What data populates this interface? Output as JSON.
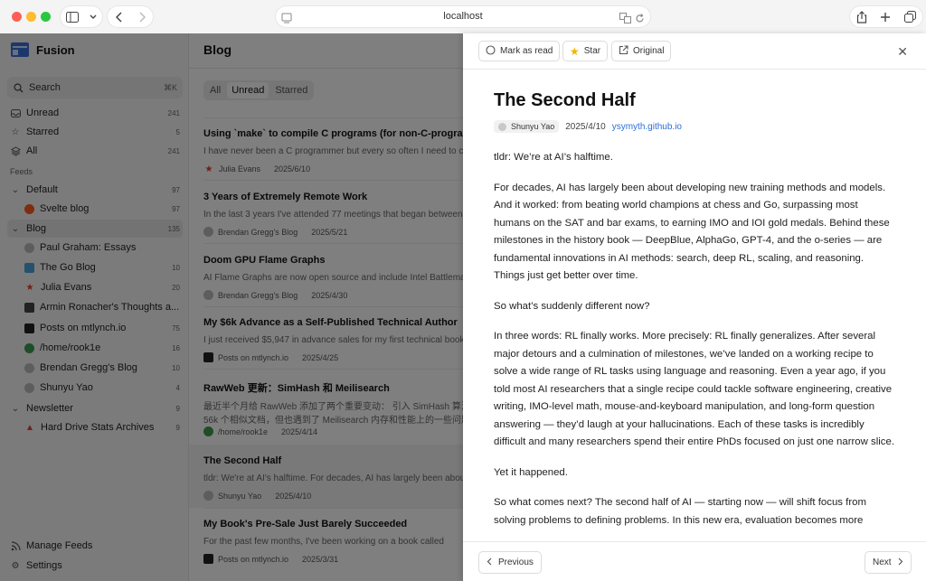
{
  "browser": {
    "url": "localhost"
  },
  "app": {
    "name": "Fusion"
  },
  "sidebar": {
    "search": {
      "label": "Search",
      "shortcut": "⌘K"
    },
    "nav": [
      {
        "label": "Unread",
        "count": "241"
      },
      {
        "label": "Starred",
        "count": "5"
      },
      {
        "label": "All",
        "count": "241"
      }
    ],
    "feeds_label": "Feeds",
    "groups": [
      {
        "label": "Default",
        "count": "97"
      },
      {
        "label": "Blog",
        "count": "135"
      },
      {
        "label": "Newsletter",
        "count": "9"
      }
    ],
    "feeds": [
      {
        "label": "Svelte blog",
        "count": "97"
      },
      {
        "label": "Paul Graham: Essays",
        "count": ""
      },
      {
        "label": "The Go Blog",
        "count": "10"
      },
      {
        "label": "Julia Evans",
        "count": "20"
      },
      {
        "label": "Armin Ronacher's Thoughts a...",
        "count": ""
      },
      {
        "label": "Posts on mtlynch.io",
        "count": "75"
      },
      {
        "label": "/home/rook1e",
        "count": "16"
      },
      {
        "label": "Brendan Gregg's Blog",
        "count": "10"
      },
      {
        "label": "Shunyu Yao",
        "count": "4"
      },
      {
        "label": "Hard Drive Stats Archives",
        "count": "9"
      }
    ],
    "manage_feeds": "Manage Feeds",
    "settings": "Settings"
  },
  "list": {
    "title": "Blog",
    "filters": [
      "All",
      "Unread",
      "Starred"
    ],
    "entries": [
      {
        "title": "Using `make` to compile C programs (for non-C-programmers)",
        "summary": "I have never been a C programmer but every so often I need to compile",
        "feed": "Julia Evans",
        "date": "2025/6/10"
      },
      {
        "title": "3 Years of Extremely Remote Work",
        "summary": "In the last 3 years I've attended 77 meetings that began between",
        "feed": "Brendan Gregg's Blog",
        "date": "2025/5/21"
      },
      {
        "title": "Doom GPU Flame Graphs",
        "summary": "AI Flame Graphs are now open source and include Intel Battlemage",
        "feed": "Brendan Gregg's Blog",
        "date": "2025/4/30"
      },
      {
        "title": "My $6k Advance as a Self-Published Technical Author",
        "summary": "I just received $5,947 in advance sales for my first technical book",
        "feed": "Posts on mtlynch.io",
        "date": "2025/4/25"
      },
      {
        "title": "RawWeb 更新：SimHash 和 Meilisearch",
        "summary": "最近半个月给 RawWeb 添加了两个重要变动： 引入 SimHash 算法",
        "summary2": "56k 个相似文档，但也遇到了 Meilisearch 内存和性能上的一些问题",
        "feed": "/home/rook1e",
        "date": "2025/4/14"
      },
      {
        "title": "The Second Half",
        "summary": "tldr: We're at AI's halftime. For decades, AI has largely been about",
        "feed": "Shunyu Yao",
        "date": "2025/4/10"
      },
      {
        "title": "My Book's Pre-Sale Just Barely Succeeded",
        "summary": "For the past few months, I've been working on a book called",
        "feed": "Posts on mtlynch.io",
        "date": "2025/3/31"
      }
    ]
  },
  "reader": {
    "toolbar": {
      "mark_read": "Mark as read",
      "star": "Star",
      "original": "Original"
    },
    "title": "The Second Half",
    "author": "Shunyu Yao",
    "date": "2025/4/10",
    "link": "ysymyth.github.io",
    "paragraphs": [
      "tldr: We’re at AI’s halftime.",
      "For decades, AI has largely been about developing new training methods and models. And it worked: from beating world champions at chess and Go, surpassing most humans on the SAT and bar exams, to earning IMO and IOI gold medals. Behind these milestones in the history book — DeepBlue, AlphaGo, GPT-4, and the o-series — are fundamental innovations in AI methods: search, deep RL, scaling, and reasoning. Things just get better over time.",
      "So what’s suddenly different now?",
      "In three words: RL finally works. More precisely: RL finally generalizes. After several major detours and a culmination of milestones, we’ve landed on a working recipe to solve a wide range of RL tasks using language and reasoning. Even a year ago, if you told most AI researchers that a single recipe could tackle software engineering, creative writing, IMO-level math, mouse-and-keyboard manipulation, and long-form question answering — they’d laugh at your hallucinations. Each of these tasks is incredibly difficult and many researchers spend their entire PhDs focused on just one narrow slice.",
      "Yet it happened.",
      "So what comes next? The second half of AI — starting now — will shift focus from solving problems to defining problems. In this new era, evaluation becomes more"
    ],
    "prev": "Previous",
    "next": "Next"
  },
  "colors": {
    "brand": "#3a6fd8",
    "star": "#f2b400",
    "link": "#2c6fd6"
  }
}
